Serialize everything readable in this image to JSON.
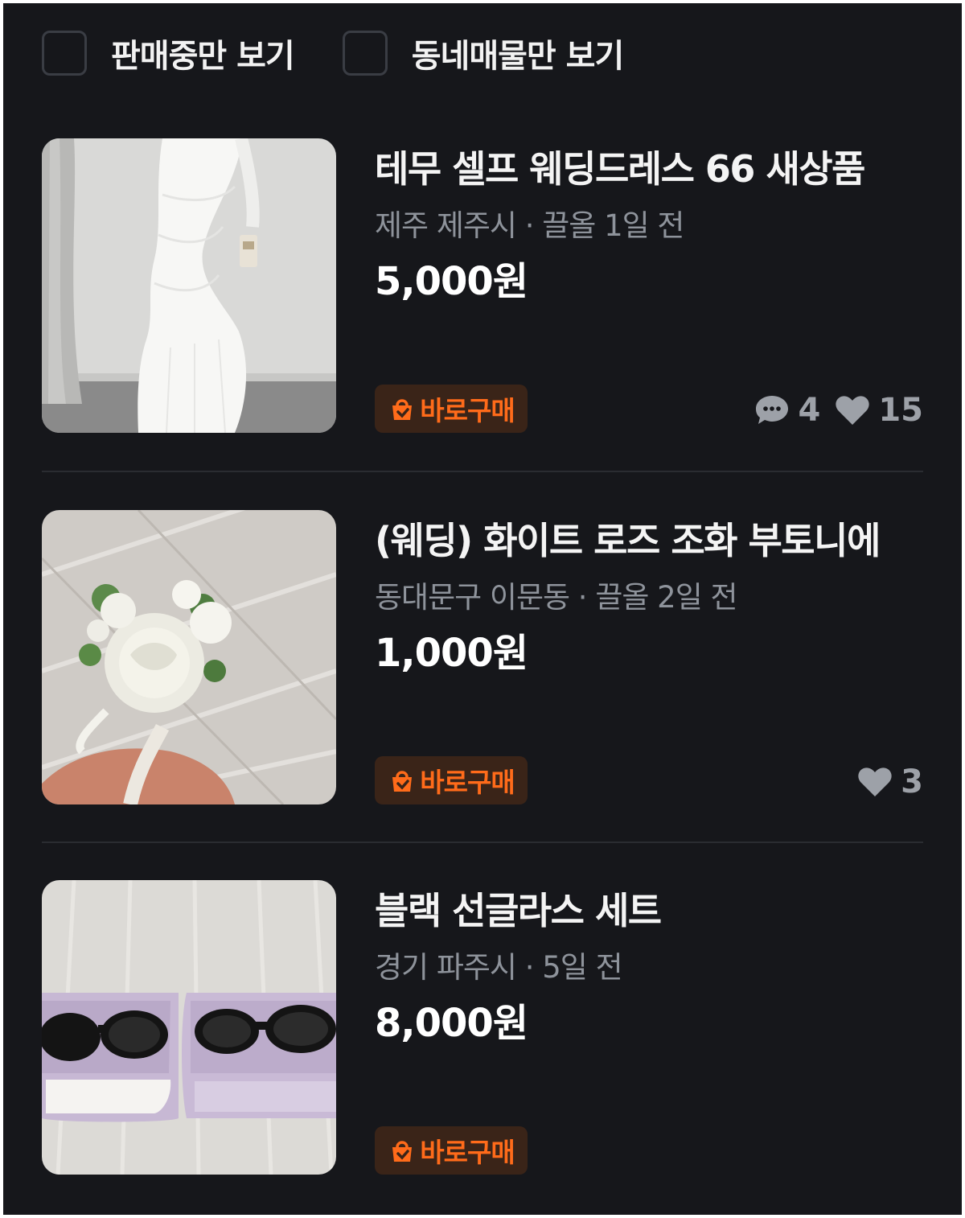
{
  "filters": [
    {
      "label": "판매중만 보기",
      "checked": false
    },
    {
      "label": "동네매물만 보기",
      "checked": false
    }
  ],
  "items": [
    {
      "title": "테무 셀프 웨딩드레스 66 새상품",
      "meta": "제주 제주시 · 끌올 1일 전",
      "price": "5,000원",
      "badge": "바로구매",
      "comments": "4",
      "likes": "15",
      "image": "white-wedding-dress-photo"
    },
    {
      "title": "(웨딩) 화이트 로즈 조화 부토니에",
      "meta": "동대문구 이문동 · 끌올 2일 전",
      "price": "1,000원",
      "badge": "바로구매",
      "likes": "3",
      "image": "white-rose-boutonniere-photo"
    },
    {
      "title": "블랙 선글라스 세트",
      "meta": "경기 파주시 · 5일 전",
      "price": "8,000원",
      "badge": "바로구매",
      "image": "black-sunglasses-in-cases-photo"
    }
  ],
  "colors": {
    "background": "#16171b",
    "accent": "#ff6b1a",
    "badge_bg": "#3a2418",
    "meta_text": "#8e939b"
  },
  "icons": [
    "chat-bubble-icon",
    "heart-icon",
    "shopping-bag-icon"
  ]
}
